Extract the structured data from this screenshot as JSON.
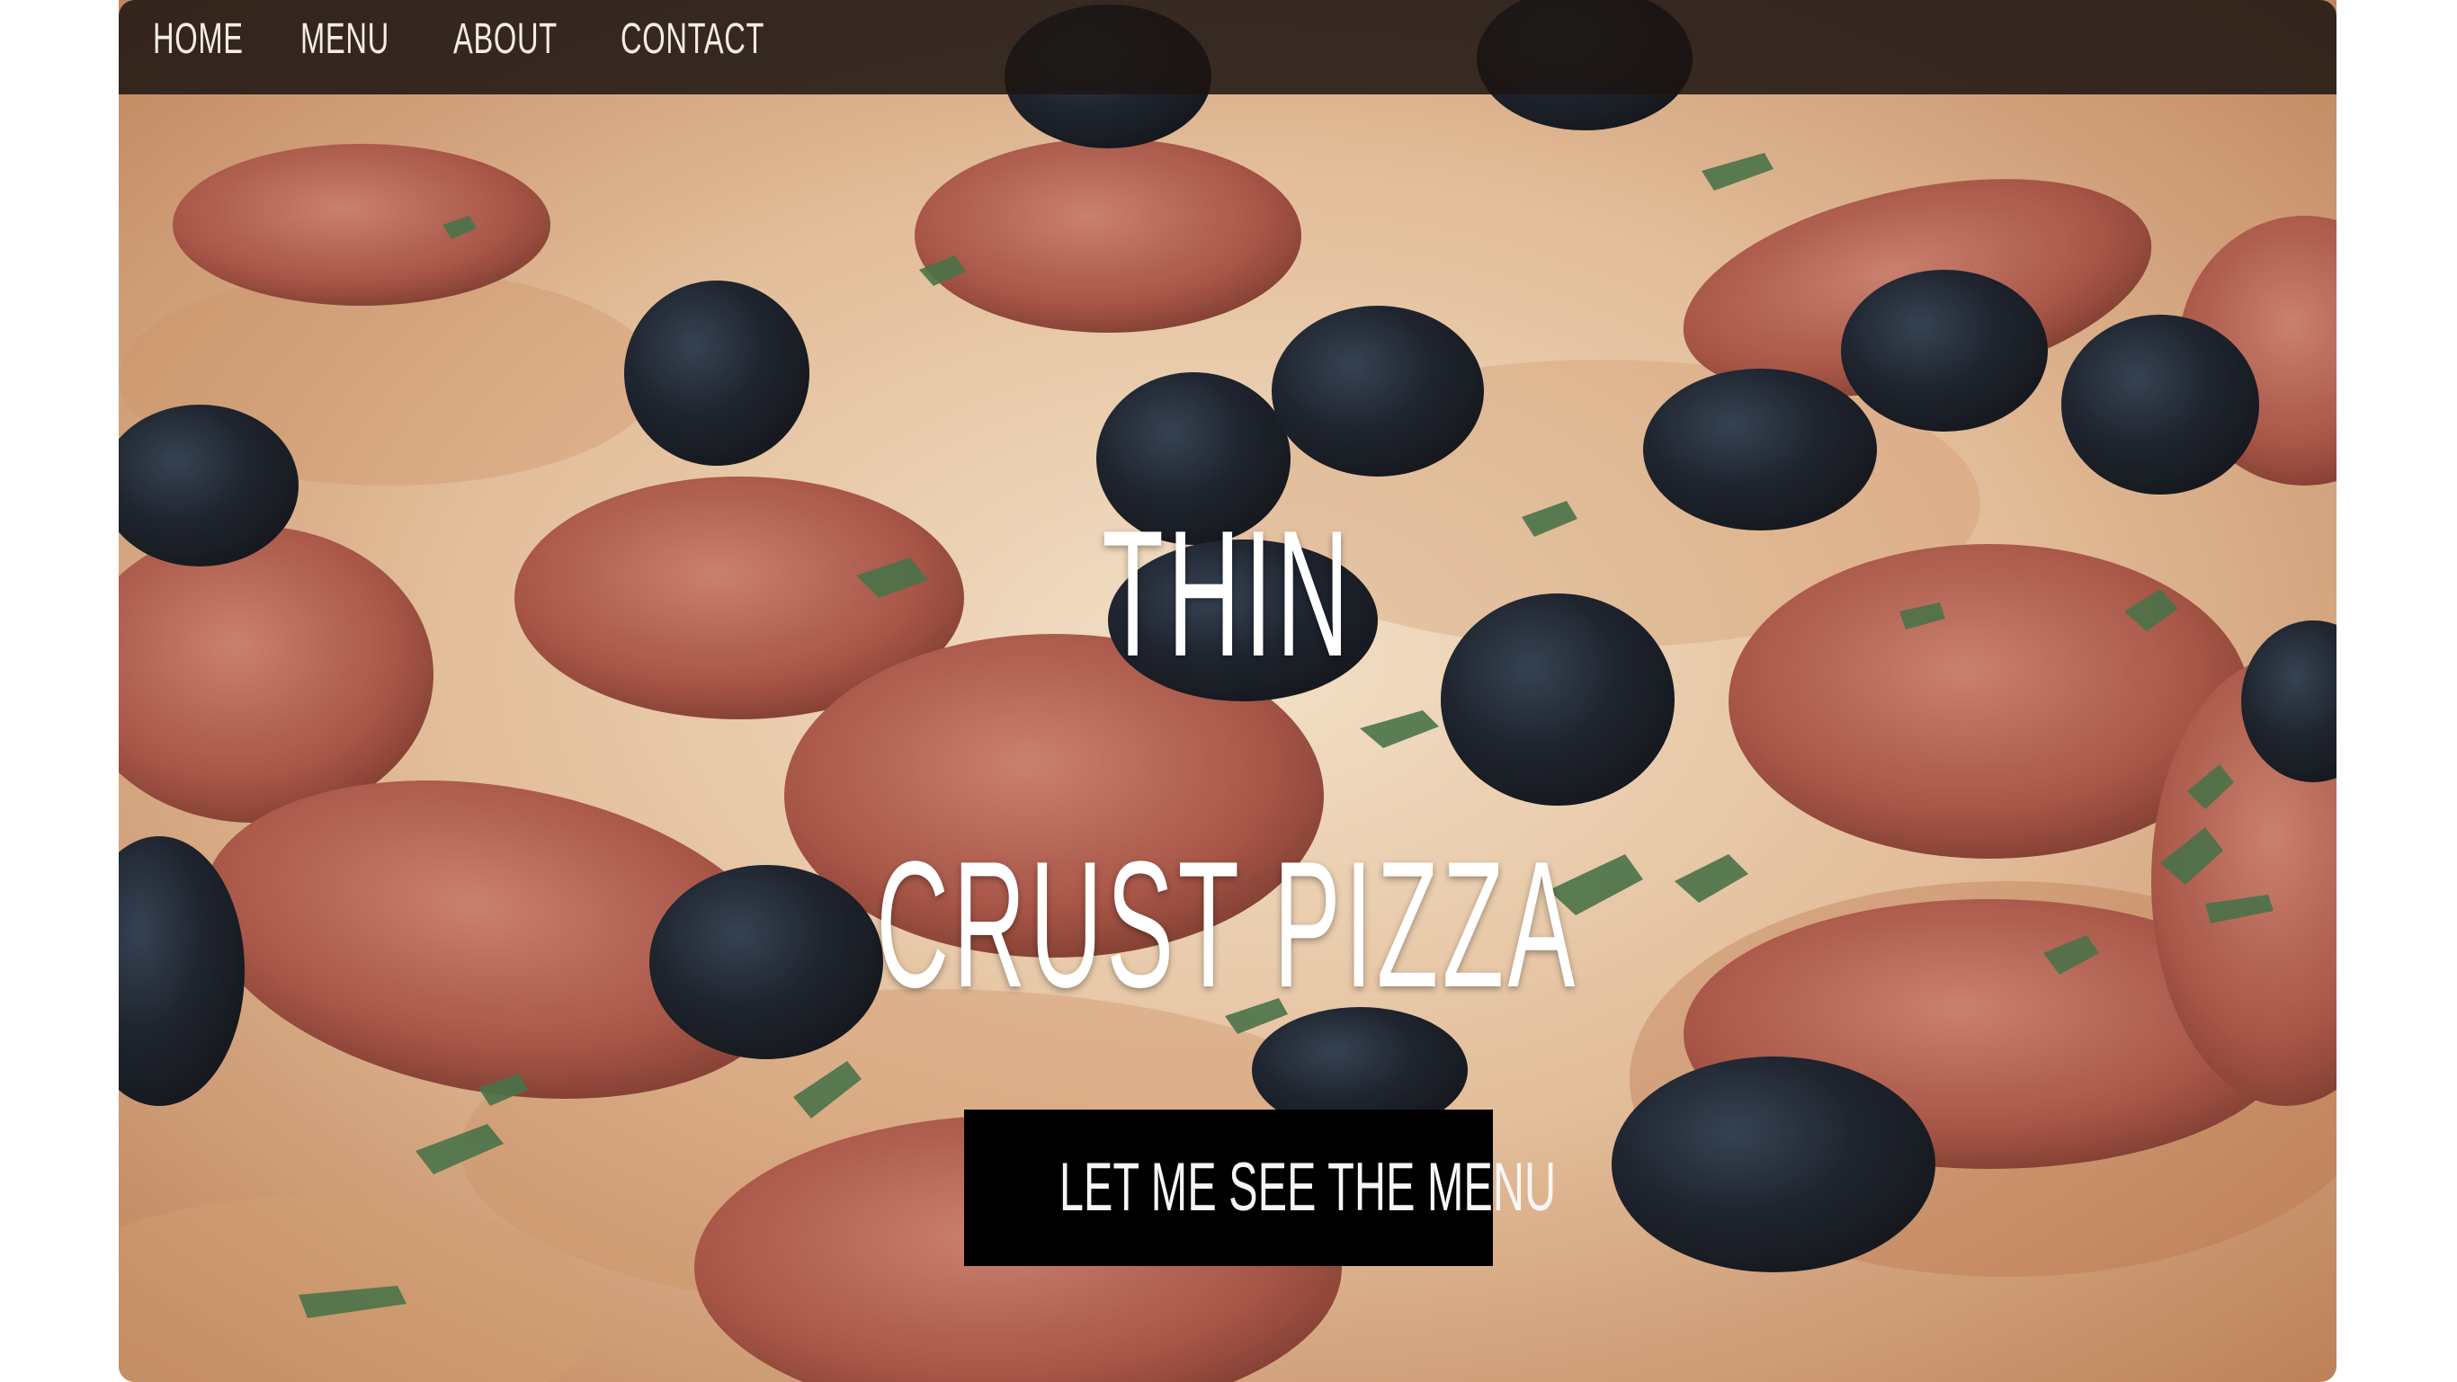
{
  "nav": {
    "items": [
      {
        "label": "HOME"
      },
      {
        "label": "MENU"
      },
      {
        "label": "ABOUT"
      },
      {
        "label": "CONTACT"
      }
    ]
  },
  "hero": {
    "title_line_1": "THIN",
    "title_line_2": "CRUST PIZZA",
    "cta_label": "LET ME SEE THE MENU",
    "image": "pepperoni-olive-pizza-photo"
  },
  "colors": {
    "nav_background": "#1c1412",
    "nav_text": "#f4eee6",
    "title_text": "#ffffff",
    "button_background": "#000000",
    "button_text": "#f6f6f6"
  }
}
